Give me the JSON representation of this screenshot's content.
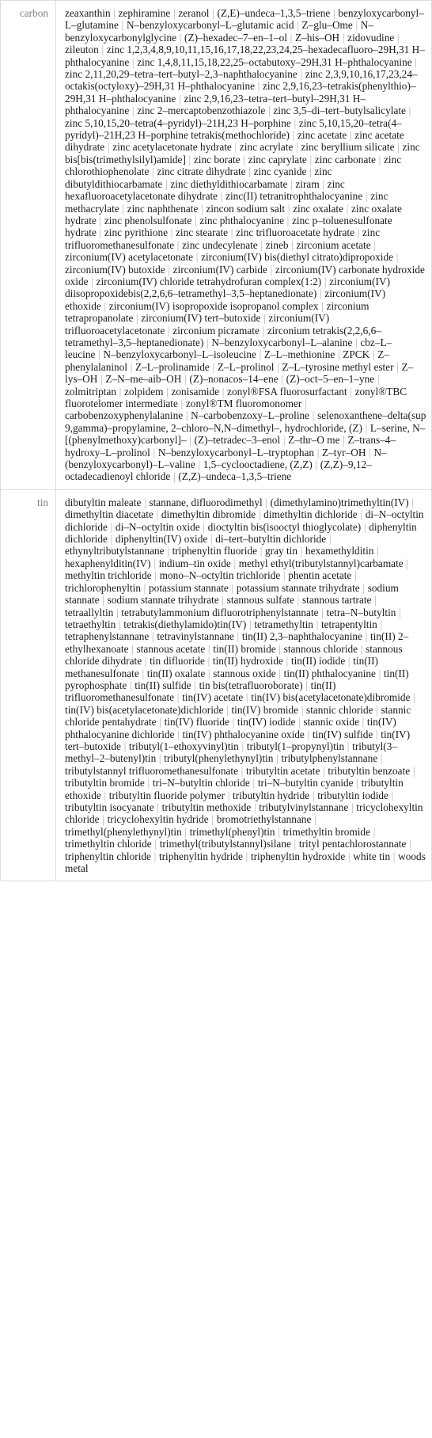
{
  "table": {
    "rows": [
      {
        "label": "carbon",
        "items": [
          "zeaxanthin",
          "zephiramine",
          "zeranol",
          "(Z,E)–undeca–1,3,5–triene",
          "benzyloxycarbonyl–L–glutamine",
          "N–benzyloxycarbonyl–L–glutamic acid",
          "Z–glu–Ome",
          "N–benzyloxycarbonylglycine",
          "(Z)–hexadec–7–en–1–ol",
          "Z–his–OH",
          "zidovudine",
          "zileuton",
          "zinc 1,2,3,4,8,9,10,11,15,16,17,18,22,23,24,25–hexadecafluoro–29H,31 H–phthalocyanine",
          "zinc 1,4,8,11,15,18,22,25–octabutoxy–29H,31 H–phthalocyanine",
          "zinc 2,11,20,29–tetra–tert–butyl–2,3–naphthalocyanine",
          "zinc 2,3,9,10,16,17,23,24–octakis(octyloxy)–29H,31 H–phthalocyanine",
          "zinc 2,9,16,23–tetrakis(phenylthio)–29H,31 H–phthalocyanine",
          "zinc 2,9,16,23–tetra–tert–butyl–29H,31 H–phthalocyanine",
          "zinc 2–mercaptobenzothiazole",
          "zinc 3,5–di–tert–butylsalicylate",
          "zinc 5,10,15,20–tetra(4–pyridyl)–21H,23 H–porphine",
          "zinc 5,10,15,20–tetra(4–pyridyl)–21H,23 H–porphine tetrakis(methochloride)",
          "zinc acetate",
          "zinc acetate dihydrate",
          "zinc acetylacetonate hydrate",
          "zinc acrylate",
          "zinc beryllium silicate",
          "zinc bis[bis(trimethylsilyl)amide]",
          "zinc borate",
          "zinc caprylate",
          "zinc carbonate",
          "zinc chlorothiophenolate",
          "zinc citrate dihydrate",
          "zinc cyanide",
          "zinc dibutyldithiocarbamate",
          "zinc diethyldithiocarbamate",
          "ziram",
          "zinc hexafluoroacetylacetonate dihydrate",
          "zinc(II) tetranitrophthalocyanine",
          "zinc methacrylate",
          "zinc naphthenate",
          "zincon sodium salt",
          "zinc oxalate",
          "zinc oxalate hydrate",
          "zinc phenolsulfonate",
          "zinc phthalocyanine",
          "zinc p–toluenesulfonate hydrate",
          "zinc pyrithione",
          "zinc stearate",
          "zinc trifluoroacetate hydrate",
          "zinc trifluoromethanesulfonate",
          "zinc undecylenate",
          "zineb",
          "zirconium acetate",
          "zirconium(IV) acetylacetonate",
          "zirconium(IV) bis(diethyl citrato)dipropoxide",
          "zirconium(IV) butoxide",
          "zirconium(IV) carbide",
          "zirconium(IV) carbonate hydroxide oxide",
          "zirconium(IV) chloride tetrahydrofuran complex(1:2)",
          "zirconium(IV) diisopropoxidebis(2,2,6,6–tetramethyl–3,5–heptanedionate)",
          "zirconium(IV) ethoxide",
          "zirconium(IV) isopropoxide isopropanol complex",
          "zirconium tetrapropanolate",
          "zirconium(IV) tert–butoxide",
          "zirconium(IV) trifluoroacetylacetonate",
          "zirconium picramate",
          "zirconium tetrakis(2,2,6,6–tetramethyl–3,5–heptanedionate)",
          "N–benzyloxycarbonyl–L–alanine",
          "cbz–L–leucine",
          "N–benzyloxycarbonyl–L–isoleucine",
          "Z–L–methionine",
          "ZPCK",
          "Z–phenylalaninol",
          "Z–L–prolinamide",
          "Z–L–prolinol",
          "Z–L–tyrosine methyl ester",
          "Z–lys–OH",
          "Z–N–me–aib–OH",
          "(Z)–nonacos–14–ene",
          "(Z)–oct–5–en–1–yne",
          "zolmitriptan",
          "zolpidem",
          "zonisamide",
          "zonyl®FSA fluorosurfactant",
          "zonyl®TBC fluorotelomer intermediate",
          "zonyl®TM fluoromonomer",
          "carbobenzoxyphenylalanine",
          "N–carbobenzoxy–L–proline",
          "selenoxanthene–delta(sup 9,gamma)–propylamine, 2–chloro–N,N–dimethyl–, hydrochloride, (Z)",
          "L–serine, N–[(phenylmethoxy)carbonyl]–",
          "(Z)–tetradec–3–enol",
          "Z–thr–O me",
          "Z–trans–4–hydroxy–L–prolinol",
          "N–benzyloxycarbonyl–L–tryptophan",
          "Z–tyr–OH",
          "N–(benzyloxycarbonyl)–L–valine",
          "1,5–cyclooctadiene, (Z,Z)",
          "(Z,Z)–9,12–octadecadienoyl chloride",
          "(Z,Z)–undeca–1,3,5–triene"
        ]
      },
      {
        "label": "tin",
        "items": [
          "dibutyltin maleate",
          "stannane, difluorodimethyl",
          "(dimethylamino)trimethyltin(IV)",
          "dimethyltin diacetate",
          "dimethyltin dibromide",
          "dimethyltin dichloride",
          "di–N–octyltin dichloride",
          "di–N–octyltin oxide",
          "dioctyltin bis(isooctyl thioglycolate)",
          "diphenyltin dichloride",
          "diphenyltin(IV) oxide",
          "di–tert–butyltin dichloride",
          "ethynyltributylstannane",
          "triphenyltin fluoride",
          "gray tin",
          "hexamethylditin",
          "hexaphenylditin(IV)",
          "indium–tin oxide",
          "methyl ethyl(tributylstannyl)carbamate",
          "methyltin trichloride",
          "mono–N–octyltin trichloride",
          "phentin acetate",
          "trichlorophenyltin",
          "potassium stannate",
          "potassium stannate trihydrate",
          "sodium stannate",
          "sodium stannate trihydrate",
          "stannous sulfate",
          "stannous tartrate",
          "tetraallyltin",
          "tetrabutylammonium difluorotriphenylstannate",
          "tetra–N–butyltin",
          "tetraethyltin",
          "tetrakis(diethylamido)tin(IV)",
          "tetramethyltin",
          "tetrapentyltin",
          "tetraphenylstannane",
          "tetravinylstannane",
          "tin(II) 2,3–naphthalocyanine",
          "tin(II) 2–ethylhexanoate",
          "stannous acetate",
          "tin(II) bromide",
          "stannous chloride",
          "stannous chloride dihydrate",
          "tin difluoride",
          "tin(II) hydroxide",
          "tin(II) iodide",
          "tin(II) methanesulfonate",
          "tin(II) oxalate",
          "stannous oxide",
          "tin(II) phthalocyanine",
          "tin(II) pyrophosphate",
          "tin(II) sulfide",
          "tin bis(tetrafluoroborate)",
          "tin(II) trifluoromethanesulfonate",
          "tin(IV) acetate",
          "tin(IV) bis(acetylacetonate)dibromide",
          "tin(IV) bis(acetylacetonate)dichloride",
          "tin(IV) bromide",
          "stannic chloride",
          "stannic chloride pentahydrate",
          "tin(IV) fluoride",
          "tin(IV) iodide",
          "stannic oxide",
          "tin(IV) phthalocyanine dichloride",
          "tin(IV) phthalocyanine oxide",
          "tin(IV) sulfide",
          "tin(IV) tert–butoxide",
          "tributyl(1–ethoxyvinyl)tin",
          "tributyl(1–propynyl)tin",
          "tributyl(3–methyl–2–butenyl)tin",
          "tributyl(phenylethynyl)tin",
          "tributylphenylstannane",
          "tributylstannyl trifluoromethanesulfonate",
          "tributyltin acetate",
          "tributyltin benzoate",
          "tributyltin bromide",
          "tri–N–butyltin chloride",
          "tri–N–butyltin cyanide",
          "tributyltin ethoxide",
          "tributyltin fluoride polymer",
          "tributyltin hydride",
          "tributyltin iodide",
          "tributyltin isocyanate",
          "tributyltin methoxide",
          "tributylvinylstannane",
          "tricyclohexyltin chloride",
          "tricyclohexyltin hydride",
          "bromotriethylstannane",
          "trimethyl(phenylethynyl)tin",
          "trimethyl(phenyl)tin",
          "trimethyltin bromide",
          "trimethyltin chloride",
          "trimethyl(tributylstannyl)silane",
          "trityl pentachlorostannate",
          "triphenyltin chloride",
          "triphenyltin hydride",
          "triphenyltin hydroxide",
          "white tin",
          "woods metal"
        ]
      }
    ],
    "separator": "|"
  },
  "colors": {
    "border": "#dcdcdc",
    "label_text": "#808080",
    "item_text": "#1a1a1a",
    "separator_text": "#b0b0b0",
    "background": "#ffffff"
  }
}
